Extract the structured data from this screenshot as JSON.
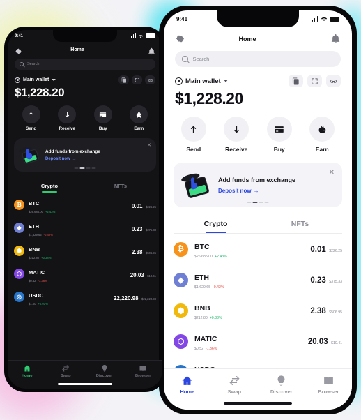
{
  "theme": {
    "page_background": "#f3f3f7",
    "dark_accent": "#2ecc71",
    "light_accent": "#2c47df",
    "up_color": "#19b86a",
    "down_color": "#e2504a"
  },
  "status_bar": {
    "time": "9:41",
    "signal_icon": "signal-bars-icon",
    "wifi_icon": "wifi-icon",
    "battery_icon": "battery-icon"
  },
  "header": {
    "title": "Home",
    "settings_icon": "gear-icon",
    "notifications_icon": "bell-icon"
  },
  "search": {
    "placeholder": "Search",
    "icon": "search-icon"
  },
  "wallet": {
    "name": "Main wallet",
    "visibility_icon": "eye-icon",
    "dropdown_icon": "chevron-down-icon",
    "balance": "$1,228.20",
    "actions": [
      {
        "icon": "copy-icon",
        "name": "copy-address"
      },
      {
        "icon": "scan-icon",
        "name": "scan-qr"
      },
      {
        "icon": "link-icon",
        "name": "connect-link"
      }
    ]
  },
  "quick_actions": [
    {
      "label": "Send",
      "icon": "arrow-up-icon"
    },
    {
      "label": "Receive",
      "icon": "arrow-down-icon"
    },
    {
      "label": "Buy",
      "icon": "card-icon"
    },
    {
      "label": "Earn",
      "icon": "piggy-bank-icon"
    }
  ],
  "banner": {
    "title": "Add funds from exchange",
    "cta": "Deposit now",
    "cta_arrow": "→",
    "close_icon": "close-icon",
    "art_icon": "exchange-deposit-illustration",
    "dots": 4,
    "active_dot": 1
  },
  "tabs": [
    {
      "label": "Crypto",
      "active": true
    },
    {
      "label": "NFTs",
      "active": false
    }
  ],
  "tokens": [
    {
      "symbol": "BTC",
      "price": "$26,685.00",
      "change": "+2.43%",
      "direction": "up",
      "amount": "0.01",
      "value": "$226.25",
      "color": "#f7931a",
      "glyph": "₿"
    },
    {
      "symbol": "ETH",
      "price": "$1,629.65",
      "change": "-0.42%",
      "direction": "down",
      "amount": "0.23",
      "value": "$375.33",
      "color": "#6f7fd4",
      "glyph": "◆"
    },
    {
      "symbol": "BNB",
      "price": "$212.80",
      "change": "+0.38%",
      "direction": "up",
      "amount": "2.38",
      "value": "$506.95",
      "color": "#f0b90b",
      "glyph": "⬢"
    },
    {
      "symbol": "MATIC",
      "price": "$0.52",
      "change": "-1.36%",
      "direction": "down",
      "amount": "20.03",
      "value": "$10.41",
      "color": "#8247e5",
      "glyph": "⬡"
    },
    {
      "symbol": "USDC",
      "price": "$1.00",
      "change": "+0.01%",
      "direction": "up",
      "amount": "22,220.98",
      "value": "$22,220.98",
      "color": "#2775ca",
      "glyph": "◎"
    }
  ],
  "bottom_nav": [
    {
      "label": "Home",
      "icon": "home-icon",
      "active": true
    },
    {
      "label": "Swap",
      "icon": "swap-icon",
      "active": false
    },
    {
      "label": "Discover",
      "icon": "bulb-icon",
      "active": false
    },
    {
      "label": "Browser",
      "icon": "book-icon",
      "active": false
    }
  ]
}
